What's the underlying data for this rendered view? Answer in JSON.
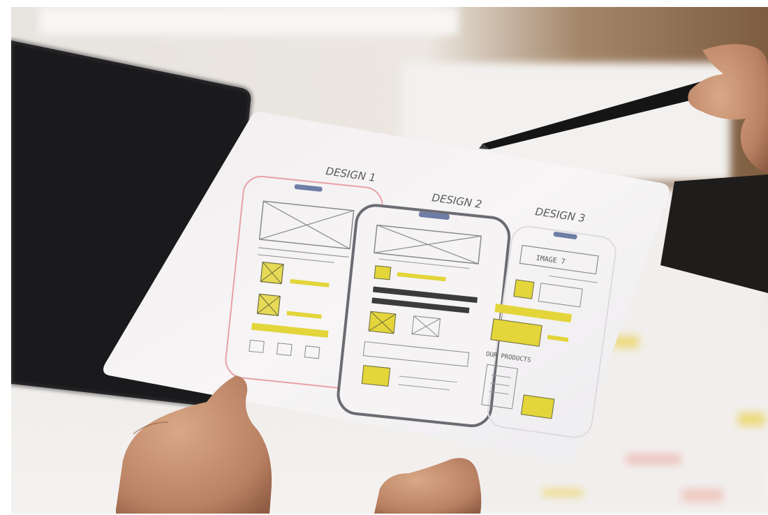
{
  "sketch": {
    "design_1_title": "DESIGN 1",
    "design_2_title": "DESIGN 2",
    "design_3_title": "DESIGN 3",
    "image_label": "IMAGE 7",
    "products_label": "OUR PRODUCTS"
  },
  "colors": {
    "highlighter": "#e3d53a",
    "pencil_gray": "#8a8a8a",
    "frame_red": "#e9a1a8",
    "frame_dark": "#6b6b72",
    "notch_blue": "#6e7da6"
  },
  "icons": {
    "pencil": "pencil-icon",
    "image_placeholder": "crossed-box-icon"
  }
}
